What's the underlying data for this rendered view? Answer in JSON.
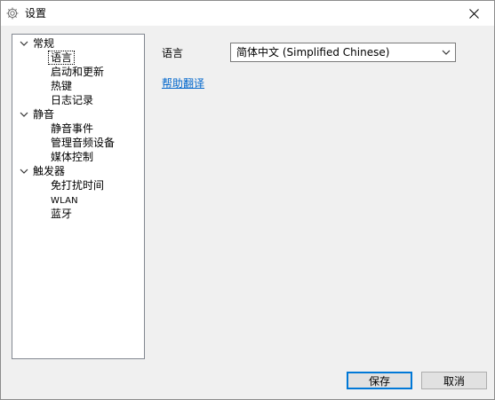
{
  "window": {
    "title": "设置",
    "close": "×"
  },
  "tree": {
    "groups": [
      {
        "label": "常规",
        "items": [
          "语言",
          "启动和更新",
          "热键",
          "日志记录"
        ]
      },
      {
        "label": "静音",
        "items": [
          "静音事件",
          "管理音频设备",
          "媒体控制"
        ]
      },
      {
        "label": "触发器",
        "items": [
          "免打扰时间",
          "WLAN",
          "蓝牙"
        ]
      }
    ],
    "selected": "语言"
  },
  "language": {
    "label": "语言",
    "value": "简体中文 (Simplified Chinese)",
    "help_link": "帮助翻译"
  },
  "buttons": {
    "save": "保存",
    "cancel": "取消"
  },
  "colors": {
    "link": "#0066cc",
    "focus_border": "#0078d7"
  }
}
